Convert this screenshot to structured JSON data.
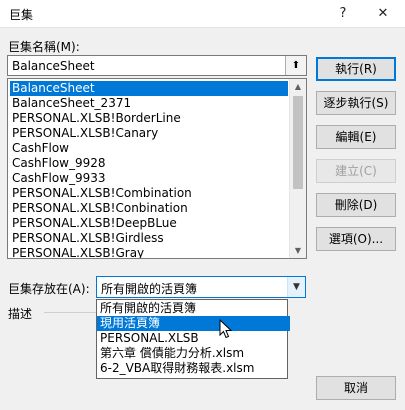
{
  "window": {
    "title": "巨集",
    "help_icon": "?",
    "close_icon": "✕"
  },
  "name_label": "巨集名稱(M):",
  "name_value": "BalanceSheet",
  "up_icon": "⬆",
  "macros": [
    "BalanceSheet",
    "BalanceSheet_2371",
    "PERSONAL.XLSB!BorderLine",
    "PERSONAL.XLSB!Canary",
    "CashFlow",
    "CashFlow_9928",
    "CashFlow_9933",
    "PERSONAL.XLSB!Combination",
    "PERSONAL.XLSB!Conbination",
    "PERSONAL.XLSB!DeepBLue",
    "PERSONAL.XLSB!Girdless",
    "PERSONAL.XLSB!Gray"
  ],
  "selected_macro_index": 0,
  "buttons": {
    "run": "執行(R)",
    "step": "逐步執行(S)",
    "edit": "編輯(E)",
    "create": "建立(C)",
    "delete": "刪除(D)",
    "options": "選項(O)...",
    "cancel": "取消"
  },
  "store_label": "巨集存放在(A):",
  "store_value": "所有開啟的活頁簿",
  "store_options": [
    "所有開啟的活頁簿",
    "現用活頁簿",
    "PERSONAL.XLSB",
    "第六章 償債能力分析.xlsm",
    "6-2_VBA取得財務報表.xlsm"
  ],
  "highlighted_option_index": 1,
  "description_label": "描述",
  "colors": {
    "accent": "#0078d7",
    "dialog_bg": "#f0f0f0"
  }
}
